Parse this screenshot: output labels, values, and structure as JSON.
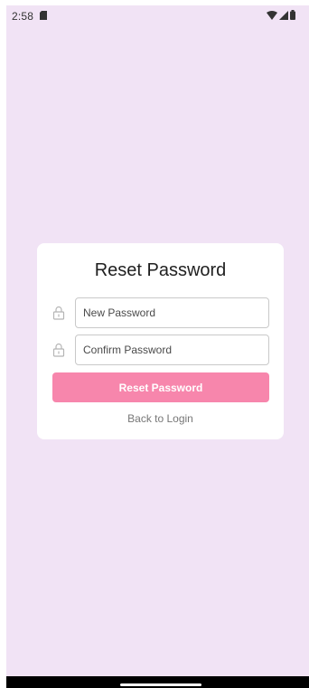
{
  "status_bar": {
    "time": "2:58",
    "icons": [
      "sim-card-icon",
      "wifi-icon",
      "cell-signal-icon",
      "battery-icon"
    ]
  },
  "reset_card": {
    "title": "Reset Password",
    "new_password": {
      "placeholder": "New Password",
      "value": "",
      "icon": "lock-icon"
    },
    "confirm_password": {
      "placeholder": "Confirm Password",
      "value": "",
      "icon": "lock-icon"
    },
    "submit_label": "Reset Password",
    "back_link_label": "Back to Login"
  },
  "colors": {
    "background": "#f1e3f5",
    "card": "#ffffff",
    "primary_button": "#f786ac",
    "link_text": "#777777"
  }
}
